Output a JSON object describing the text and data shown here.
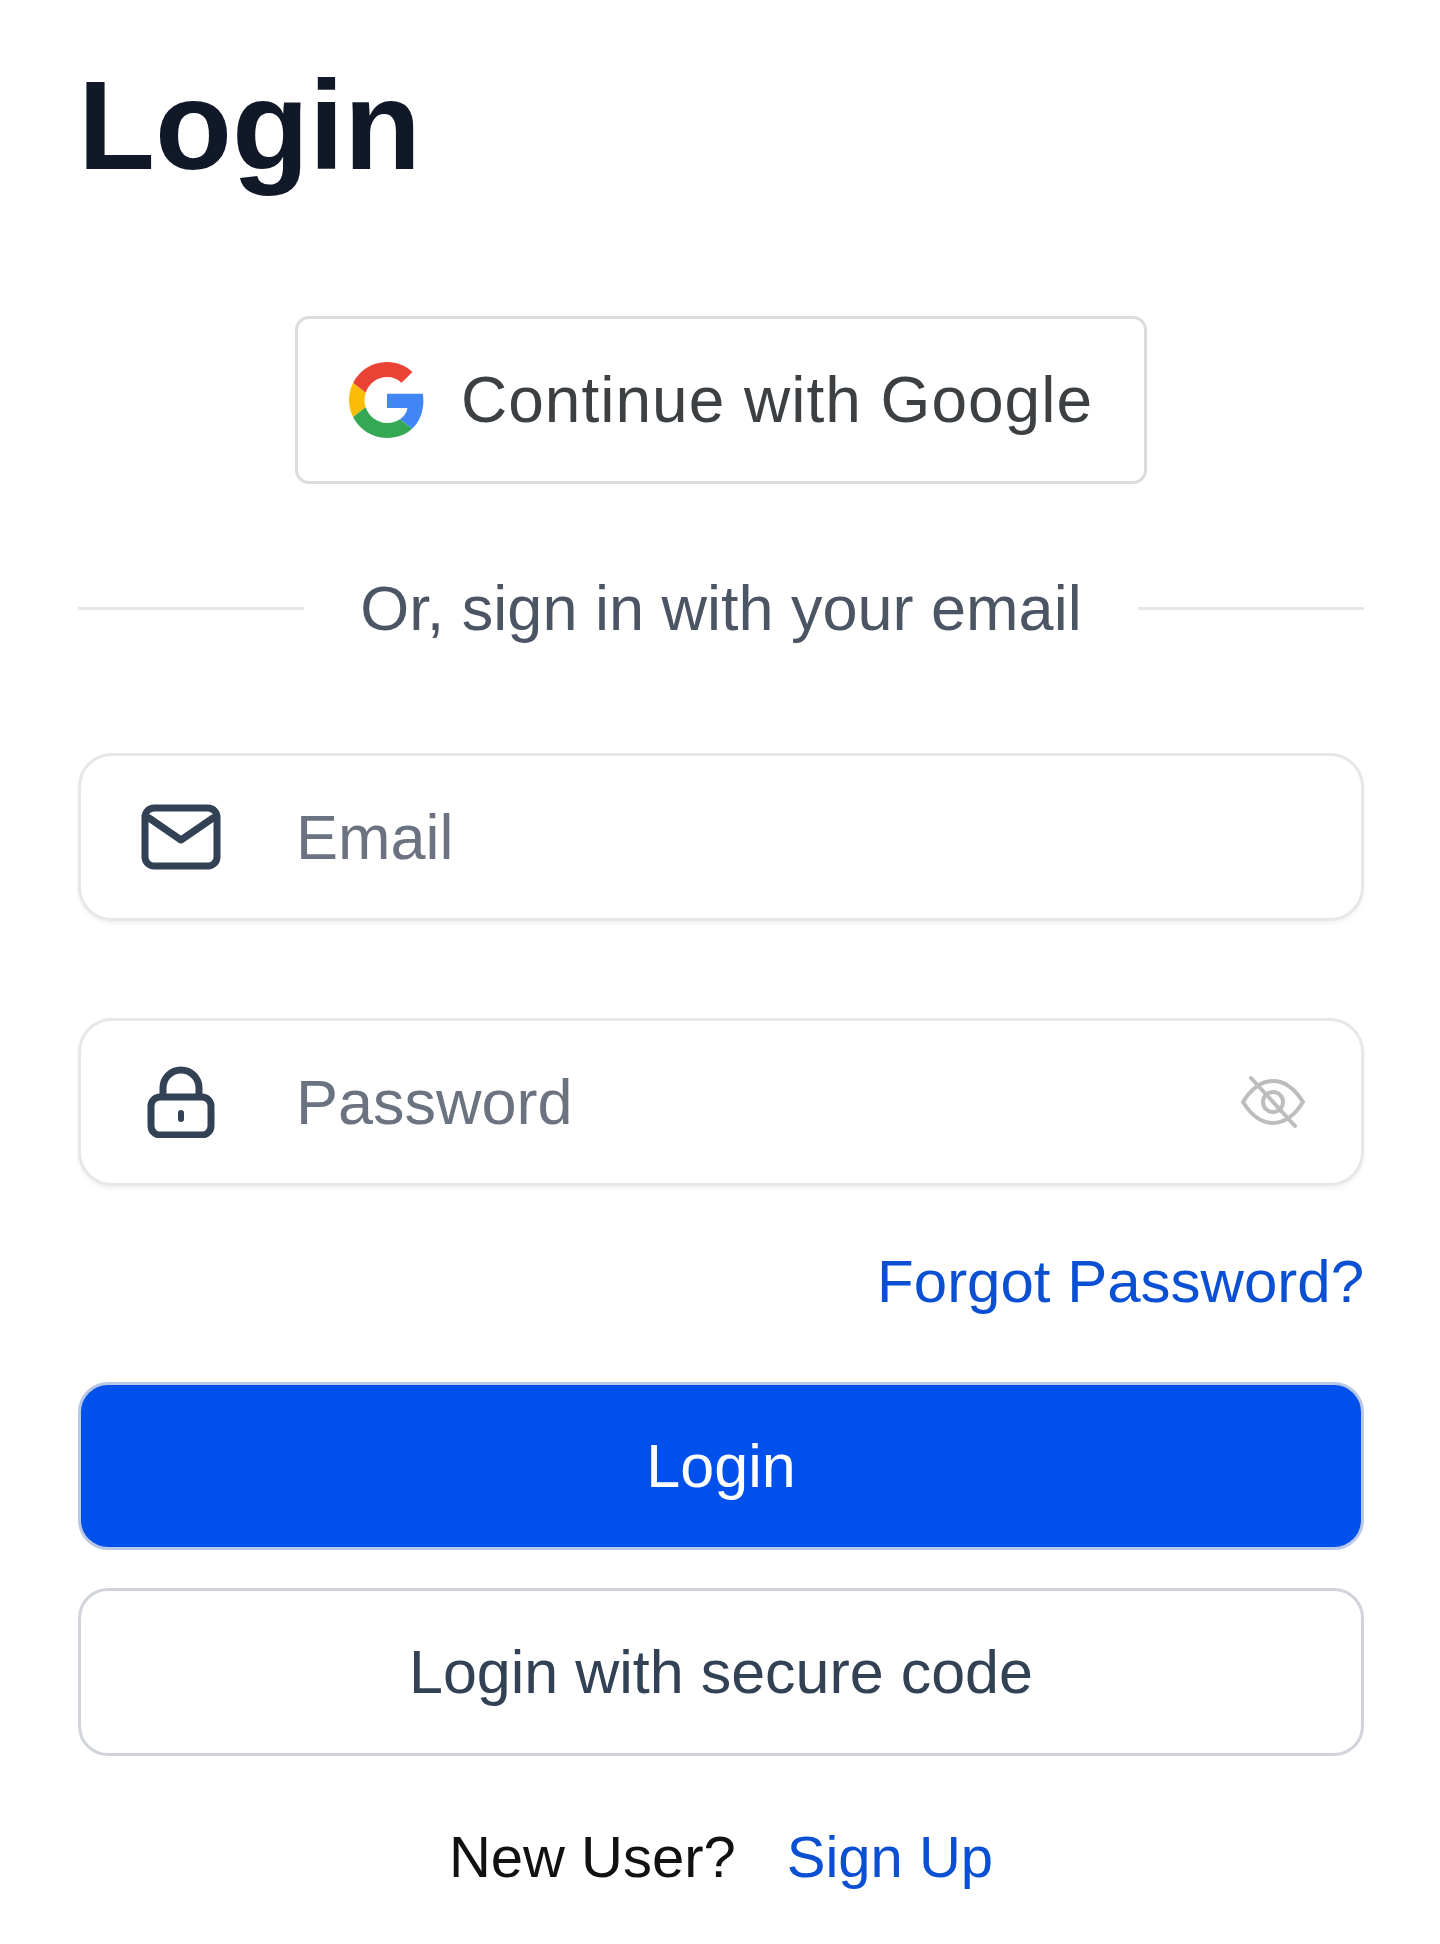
{
  "title": "Login",
  "google_button": {
    "label": "Continue with Google"
  },
  "divider": {
    "label": "Or, sign in with your email"
  },
  "fields": [
    {
      "kind": "email",
      "placeholder": "Email"
    },
    {
      "kind": "password",
      "placeholder": "Password",
      "revealed": false
    }
  ],
  "forgot_link": {
    "label": "Forgot Password?"
  },
  "buttons": [
    {
      "kind": "primary",
      "label": "Login"
    },
    {
      "kind": "secondary",
      "label": "Login with secure code"
    }
  ],
  "signup": {
    "prompt": "New User?",
    "link": "Sign Up"
  }
}
